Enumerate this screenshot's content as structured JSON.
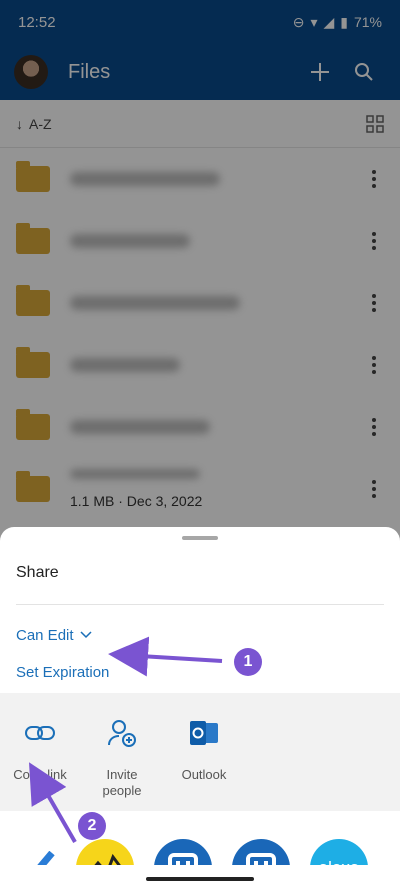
{
  "status": {
    "time": "12:52",
    "battery": "71%"
  },
  "appbar": {
    "title": "Files"
  },
  "sort": {
    "label": "A-Z"
  },
  "files": [
    {
      "meta": ""
    },
    {
      "meta": ""
    },
    {
      "meta": ""
    },
    {
      "meta": ""
    },
    {
      "meta": ""
    },
    {
      "meta": "1.1 MB · Dec 3, 2022"
    }
  ],
  "sheet": {
    "title": "Share",
    "permission": "Can Edit",
    "set_expiration": "Set Expiration",
    "actions": [
      {
        "label": "Copy link",
        "icon": "link-icon"
      },
      {
        "label": "Invite people",
        "icon": "invite-person-icon"
      },
      {
        "label": "Outlook",
        "icon": "outlook-icon"
      }
    ]
  },
  "annotations": {
    "step1": "1",
    "step2": "2"
  },
  "apps": {
    "alexa_label": "alexa"
  },
  "colors": {
    "brand": "#0a4b8c",
    "link": "#1b6fb8",
    "annotation": "#7a54d1"
  }
}
